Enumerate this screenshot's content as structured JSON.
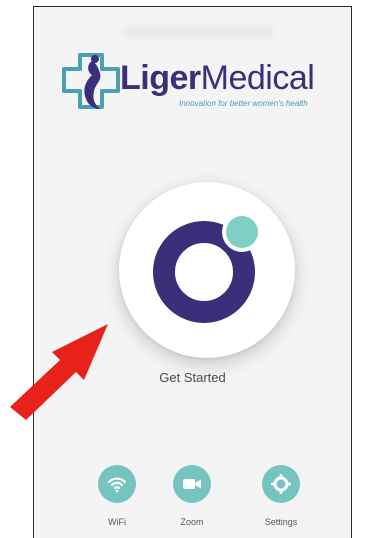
{
  "brand": {
    "name_part1": "Liger",
    "name_part2": "Medical",
    "tagline": "Innovation for better women's health"
  },
  "main": {
    "start_label": "Get Started"
  },
  "bottom_nav": {
    "items": [
      {
        "label": "WiFi",
        "icon": "wifi-icon"
      },
      {
        "label": "Zoom",
        "icon": "video-camera-icon"
      },
      {
        "label": "Settings",
        "icon": "gear-icon"
      }
    ]
  },
  "colors": {
    "brand_purple": "#3a2f7a",
    "accent_teal": "#76c4c0",
    "annotation_arrow": "#e8211a"
  }
}
